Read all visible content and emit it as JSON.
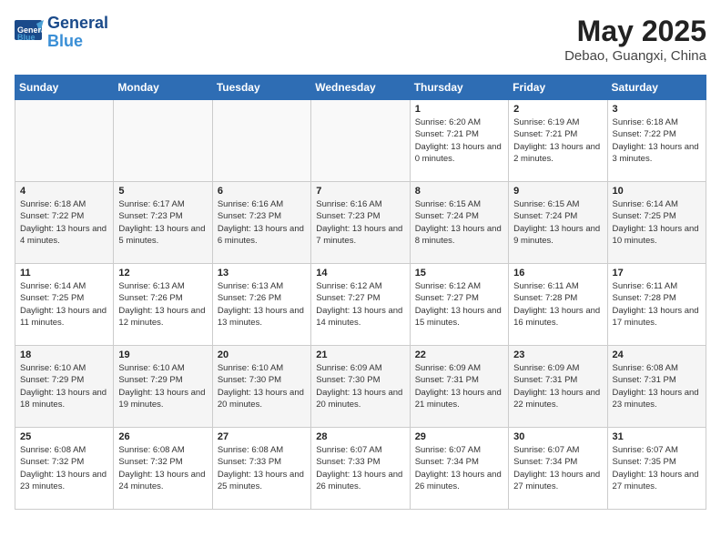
{
  "header": {
    "logo_line1": "General",
    "logo_line2": "Blue",
    "month_year": "May 2025",
    "location": "Debao, Guangxi, China"
  },
  "days_of_week": [
    "Sunday",
    "Monday",
    "Tuesday",
    "Wednesday",
    "Thursday",
    "Friday",
    "Saturday"
  ],
  "weeks": [
    [
      {
        "day": "",
        "info": ""
      },
      {
        "day": "",
        "info": ""
      },
      {
        "day": "",
        "info": ""
      },
      {
        "day": "",
        "info": ""
      },
      {
        "day": "1",
        "info": "Sunrise: 6:20 AM\nSunset: 7:21 PM\nDaylight: 13 hours and 0 minutes."
      },
      {
        "day": "2",
        "info": "Sunrise: 6:19 AM\nSunset: 7:21 PM\nDaylight: 13 hours and 2 minutes."
      },
      {
        "day": "3",
        "info": "Sunrise: 6:18 AM\nSunset: 7:22 PM\nDaylight: 13 hours and 3 minutes."
      }
    ],
    [
      {
        "day": "4",
        "info": "Sunrise: 6:18 AM\nSunset: 7:22 PM\nDaylight: 13 hours and 4 minutes."
      },
      {
        "day": "5",
        "info": "Sunrise: 6:17 AM\nSunset: 7:23 PM\nDaylight: 13 hours and 5 minutes."
      },
      {
        "day": "6",
        "info": "Sunrise: 6:16 AM\nSunset: 7:23 PM\nDaylight: 13 hours and 6 minutes."
      },
      {
        "day": "7",
        "info": "Sunrise: 6:16 AM\nSunset: 7:23 PM\nDaylight: 13 hours and 7 minutes."
      },
      {
        "day": "8",
        "info": "Sunrise: 6:15 AM\nSunset: 7:24 PM\nDaylight: 13 hours and 8 minutes."
      },
      {
        "day": "9",
        "info": "Sunrise: 6:15 AM\nSunset: 7:24 PM\nDaylight: 13 hours and 9 minutes."
      },
      {
        "day": "10",
        "info": "Sunrise: 6:14 AM\nSunset: 7:25 PM\nDaylight: 13 hours and 10 minutes."
      }
    ],
    [
      {
        "day": "11",
        "info": "Sunrise: 6:14 AM\nSunset: 7:25 PM\nDaylight: 13 hours and 11 minutes."
      },
      {
        "day": "12",
        "info": "Sunrise: 6:13 AM\nSunset: 7:26 PM\nDaylight: 13 hours and 12 minutes."
      },
      {
        "day": "13",
        "info": "Sunrise: 6:13 AM\nSunset: 7:26 PM\nDaylight: 13 hours and 13 minutes."
      },
      {
        "day": "14",
        "info": "Sunrise: 6:12 AM\nSunset: 7:27 PM\nDaylight: 13 hours and 14 minutes."
      },
      {
        "day": "15",
        "info": "Sunrise: 6:12 AM\nSunset: 7:27 PM\nDaylight: 13 hours and 15 minutes."
      },
      {
        "day": "16",
        "info": "Sunrise: 6:11 AM\nSunset: 7:28 PM\nDaylight: 13 hours and 16 minutes."
      },
      {
        "day": "17",
        "info": "Sunrise: 6:11 AM\nSunset: 7:28 PM\nDaylight: 13 hours and 17 minutes."
      }
    ],
    [
      {
        "day": "18",
        "info": "Sunrise: 6:10 AM\nSunset: 7:29 PM\nDaylight: 13 hours and 18 minutes."
      },
      {
        "day": "19",
        "info": "Sunrise: 6:10 AM\nSunset: 7:29 PM\nDaylight: 13 hours and 19 minutes."
      },
      {
        "day": "20",
        "info": "Sunrise: 6:10 AM\nSunset: 7:30 PM\nDaylight: 13 hours and 20 minutes."
      },
      {
        "day": "21",
        "info": "Sunrise: 6:09 AM\nSunset: 7:30 PM\nDaylight: 13 hours and 20 minutes."
      },
      {
        "day": "22",
        "info": "Sunrise: 6:09 AM\nSunset: 7:31 PM\nDaylight: 13 hours and 21 minutes."
      },
      {
        "day": "23",
        "info": "Sunrise: 6:09 AM\nSunset: 7:31 PM\nDaylight: 13 hours and 22 minutes."
      },
      {
        "day": "24",
        "info": "Sunrise: 6:08 AM\nSunset: 7:31 PM\nDaylight: 13 hours and 23 minutes."
      }
    ],
    [
      {
        "day": "25",
        "info": "Sunrise: 6:08 AM\nSunset: 7:32 PM\nDaylight: 13 hours and 23 minutes."
      },
      {
        "day": "26",
        "info": "Sunrise: 6:08 AM\nSunset: 7:32 PM\nDaylight: 13 hours and 24 minutes."
      },
      {
        "day": "27",
        "info": "Sunrise: 6:08 AM\nSunset: 7:33 PM\nDaylight: 13 hours and 25 minutes."
      },
      {
        "day": "28",
        "info": "Sunrise: 6:07 AM\nSunset: 7:33 PM\nDaylight: 13 hours and 26 minutes."
      },
      {
        "day": "29",
        "info": "Sunrise: 6:07 AM\nSunset: 7:34 PM\nDaylight: 13 hours and 26 minutes."
      },
      {
        "day": "30",
        "info": "Sunrise: 6:07 AM\nSunset: 7:34 PM\nDaylight: 13 hours and 27 minutes."
      },
      {
        "day": "31",
        "info": "Sunrise: 6:07 AM\nSunset: 7:35 PM\nDaylight: 13 hours and 27 minutes."
      }
    ]
  ]
}
